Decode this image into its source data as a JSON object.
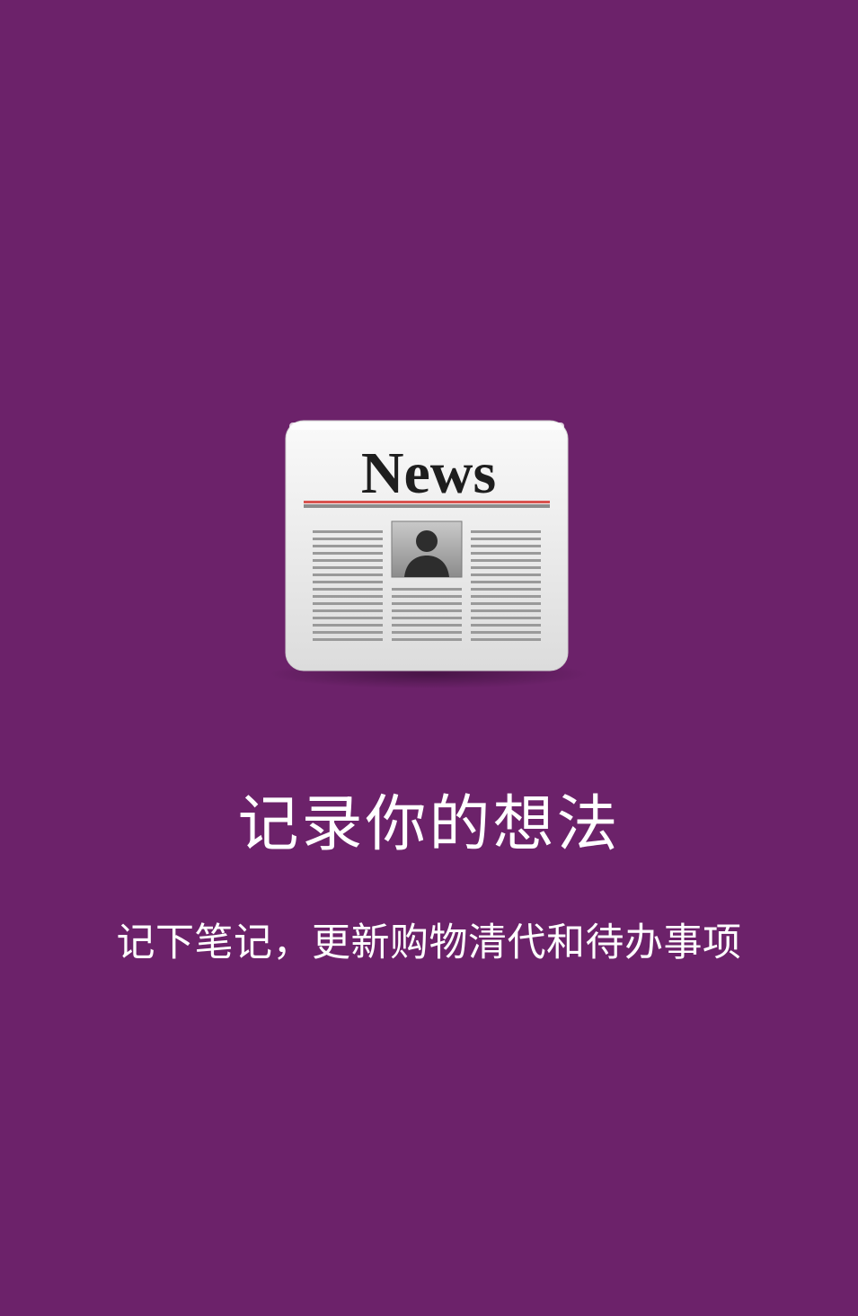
{
  "splash": {
    "logo": {
      "icon": "newspaper-icon",
      "masthead": "News"
    },
    "title": "记录你的想法",
    "subtitle": "记下笔记，更新购物清代和待办事项"
  },
  "colors": {
    "background": "#6c226a",
    "text": "#ffffff",
    "masthead_rule": "#d9534f"
  }
}
